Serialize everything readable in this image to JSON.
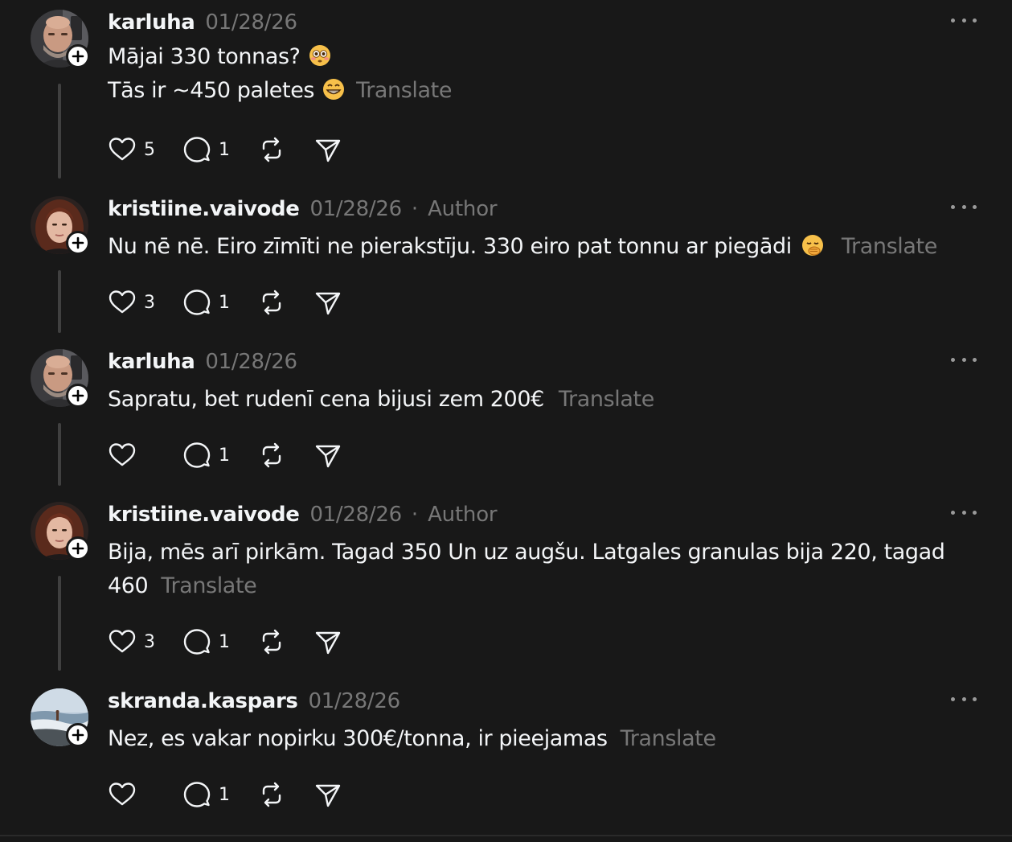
{
  "theme": {
    "background": "#181818",
    "text_primary": "#f3f5f7",
    "text_secondary": "#777777",
    "thread_line": "#404040"
  },
  "posts": [
    {
      "username": "karluha",
      "timestamp": "01/28/26",
      "author_badge": "",
      "lines": [
        "Mājai 330 tonnas?",
        "Tās ir ~450 paletes"
      ],
      "emojis": [
        "flushed-face",
        "grinning-face"
      ],
      "translate": "Translate",
      "likes": "5",
      "replies": "1"
    },
    {
      "username": "kristiine.vaivode",
      "timestamp": "01/28/26",
      "separator": "·",
      "author_badge": "Author",
      "lines": [
        "Nu nē nē. Eiro zīmīti ne pierakstīju. 330 eiro pat tonnu ar piegādi"
      ],
      "emojis": [
        "hand-over-mouth-face"
      ],
      "translate": "Translate",
      "likes": "3",
      "replies": "1"
    },
    {
      "username": "karluha",
      "timestamp": "01/28/26",
      "author_badge": "",
      "lines": [
        "Sapratu, bet rudenī cena bijusi zem 200€"
      ],
      "emojis": [],
      "translate": "Translate",
      "likes": "",
      "replies": "1"
    },
    {
      "username": "kristiine.vaivode",
      "timestamp": "01/28/26",
      "separator": "·",
      "author_badge": "Author",
      "lines": [
        "Bija, mēs arī pirkām. Tagad 350 Un uz augšu. Latgales granulas bija 220, tagad",
        "460"
      ],
      "emojis": [],
      "translate": "Translate",
      "likes": "3",
      "replies": "1"
    },
    {
      "username": "skranda.kaspars",
      "timestamp": "01/28/26",
      "author_badge": "",
      "lines": [
        "Nez, es vakar nopirku 300€/tonna, ir pieejamas"
      ],
      "emojis": [],
      "translate": "Translate",
      "likes": "",
      "replies": "1"
    }
  ],
  "icons": {
    "like": "heart-icon",
    "reply": "comment-bubble-icon",
    "repost": "repost-arrows-icon",
    "share": "paper-plane-share-icon",
    "more": "more-dots-icon",
    "follow": "plus-icon"
  }
}
